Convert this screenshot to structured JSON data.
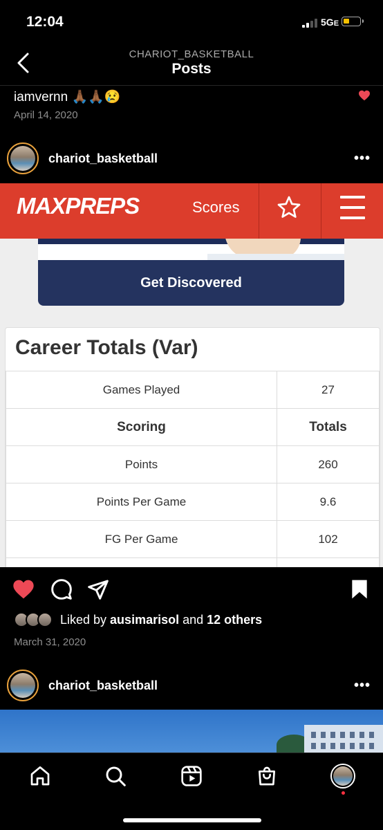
{
  "status_bar": {
    "time": "12:04",
    "network": "5G",
    "network_suffix": "E",
    "battery_color": "#f5c000"
  },
  "header": {
    "account": "CHARIOT_BASKETBALL",
    "title": "Posts"
  },
  "comment": {
    "username": "iamvernn",
    "emoji": "🙏🏾🙏🏾😢",
    "date": "April 14, 2020"
  },
  "post1": {
    "username": "chariot_basketball",
    "more_label": "•••",
    "image": {
      "brand_logo": "MAXPREPS",
      "nav_scores": "Scores",
      "promo_button": "Get Discovered",
      "card_title": "Career Totals (Var)",
      "rows": [
        {
          "label": "Games Played",
          "value": "27",
          "header": false
        },
        {
          "label": "Scoring",
          "value": "Totals",
          "header": true
        },
        {
          "label": "Points",
          "value": "260",
          "header": false
        },
        {
          "label": "Points Per Game",
          "value": "9.6",
          "header": false
        },
        {
          "label": "FG Per Game",
          "value": "102",
          "header": false
        },
        {
          "label": "",
          "value": "",
          "header": false
        }
      ]
    },
    "liked_prefix": "Liked by ",
    "liked_user": "ausimarisol",
    "liked_mid": " and ",
    "liked_others": "12 others",
    "date": "March 31, 2020"
  },
  "post2": {
    "username": "chariot_basketball",
    "more_label": "•••"
  },
  "colors": {
    "maxpreps_red": "#dc3d2c",
    "promo_navy": "#24335f",
    "like_red": "#ed4956"
  }
}
